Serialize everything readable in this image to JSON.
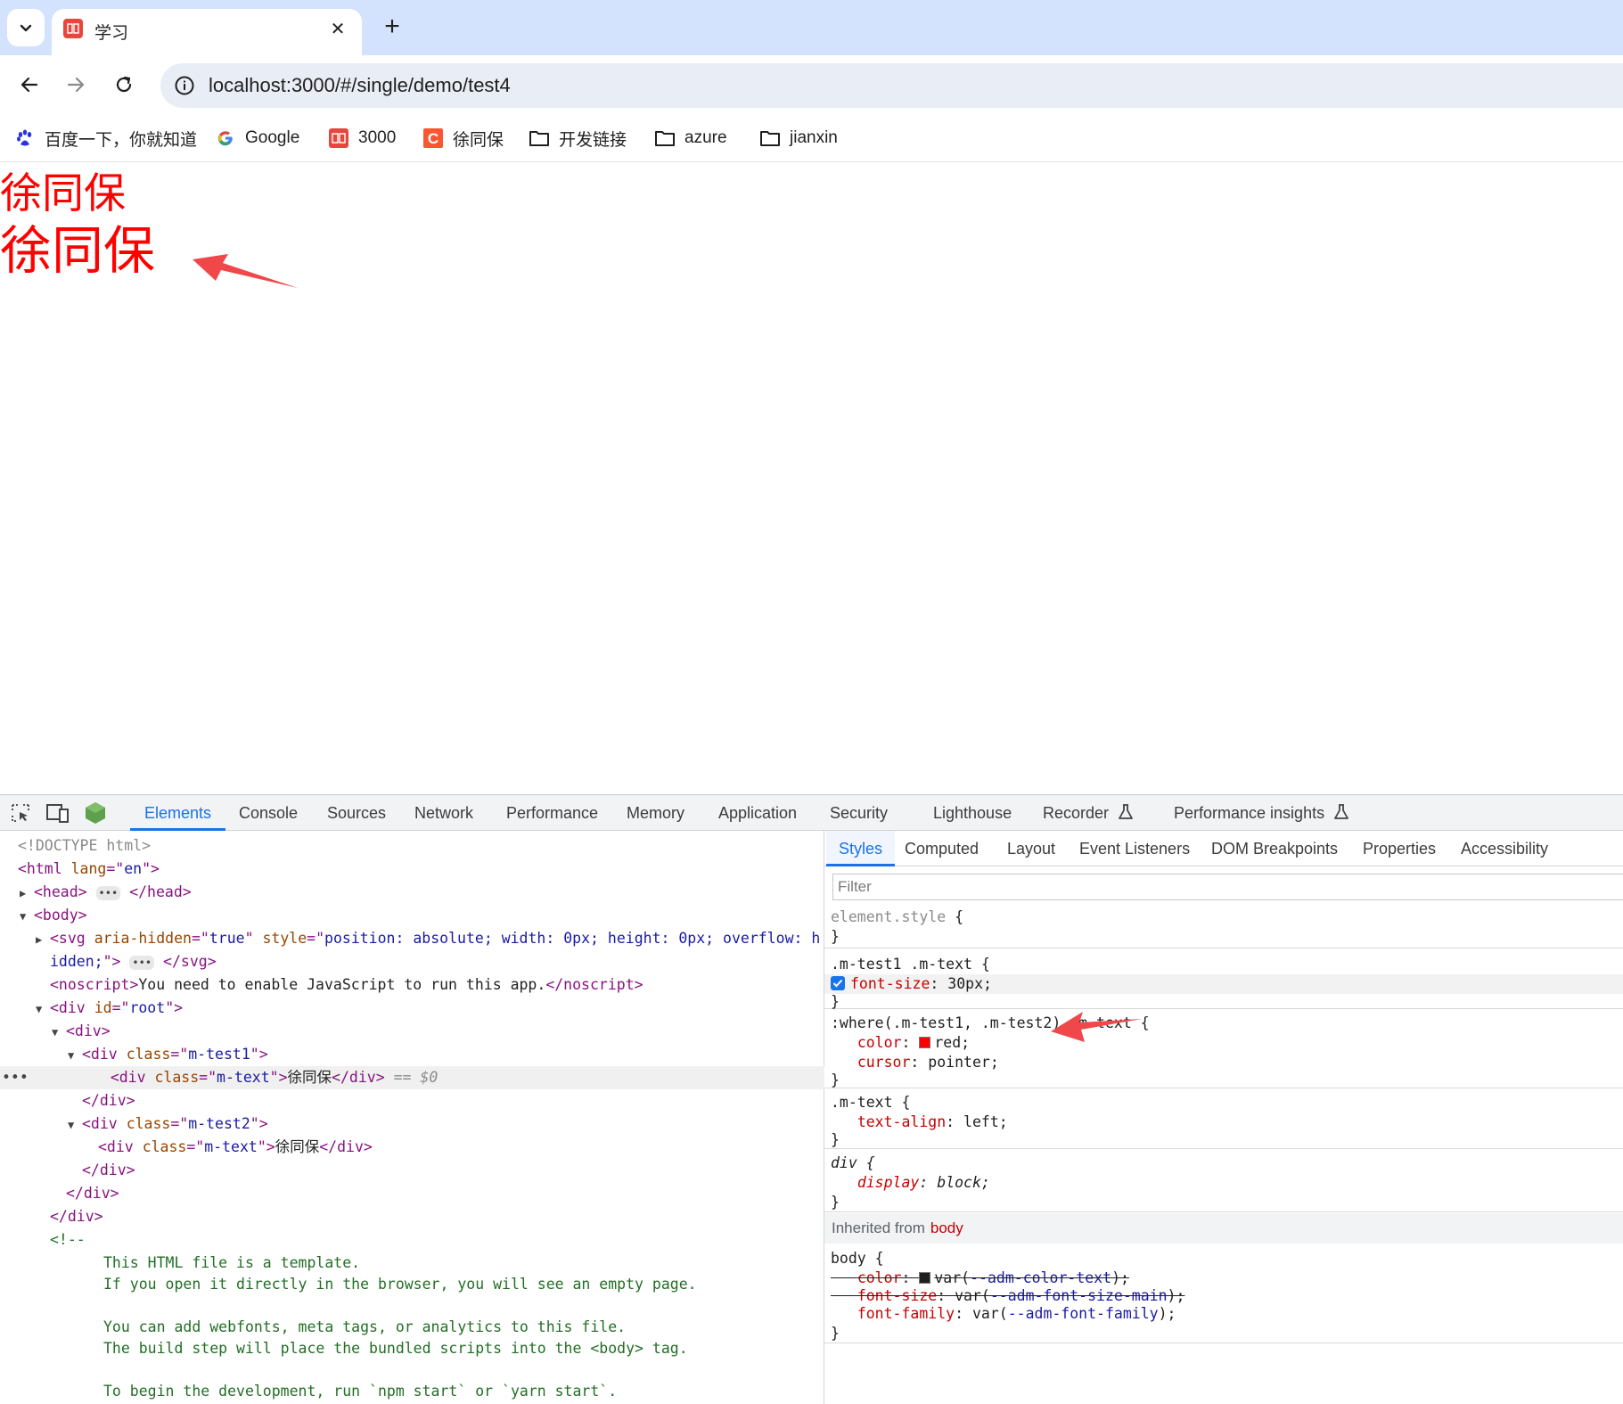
{
  "browser": {
    "tab": {
      "title": "学习"
    },
    "address": {
      "url": "localhost:3000/#/single/demo/test4"
    },
    "bookmarks": [
      {
        "label": "百度一下，你就知道",
        "icon": "baidu-paw-icon"
      },
      {
        "label": "Google",
        "icon": "google-g-icon"
      },
      {
        "label": "3000",
        "icon": "book-favicon-icon"
      },
      {
        "label": "徐同保",
        "icon": "csdn-c-icon"
      },
      {
        "label": "开发链接",
        "icon": "folder-icon"
      },
      {
        "label": "azure",
        "icon": "folder-icon"
      },
      {
        "label": "jianxin",
        "icon": "folder-icon"
      }
    ]
  },
  "page": {
    "text1": "徐同保",
    "text2": "徐同保",
    "text_color": "#ff0000",
    "annotation_arrow_color": "#f0474a"
  },
  "devtools": {
    "tabs": [
      "Elements",
      "Console",
      "Sources",
      "Network",
      "Performance",
      "Memory",
      "Application",
      "Security",
      "Lighthouse",
      "Recorder",
      "Performance insights"
    ],
    "active_tab": "Elements",
    "elements": {
      "doctype": "<!DOCTYPE html>",
      "noscript_text": "You need to enable JavaScript to run this app.",
      "node_text_1": "徐同保",
      "node_text_2": "徐同保",
      "selected_marker": "== $0",
      "comment_lines": [
        "This HTML file is a template.",
        "If you open it directly in the browser, you will see an empty page.",
        "You can add webfonts, meta tags, or analytics to this file.",
        "The build step will place the bundled scripts into the <body> tag.",
        "To begin the development, run `npm start` or `yarn start`."
      ]
    },
    "styles": {
      "tabs": [
        "Styles",
        "Computed",
        "Layout",
        "Event Listeners",
        "DOM Breakpoints",
        "Properties",
        "Accessibility"
      ],
      "active_tab": "Styles",
      "filter_placeholder": "Filter",
      "inherited_label": "Inherited from",
      "inherited_source": "body"
    }
  }
}
